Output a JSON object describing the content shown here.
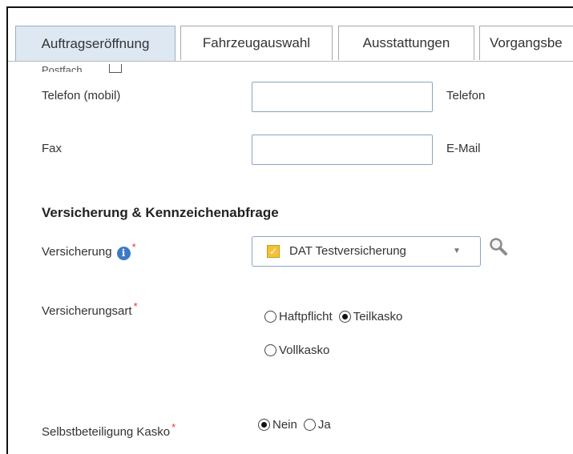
{
  "tabs": [
    {
      "label": "Auftragseröffnung",
      "active": true
    },
    {
      "label": "Fahrzeugauswahl",
      "active": false
    },
    {
      "label": "Ausstattungen",
      "active": false
    },
    {
      "label": "Vorgangsbe",
      "active": false
    }
  ],
  "partial": {
    "label": "Postfach"
  },
  "contact": {
    "phone_mobile_label": "Telefon (mobil)",
    "phone_label": "Telefon",
    "fax_label": "Fax",
    "email_label": "E-Mail"
  },
  "insurance_section": {
    "title": "Versicherung & Kennzeichenabfrage",
    "insurance_label": "Versicherung",
    "info_icon": "i",
    "required_mark": "*",
    "insurance_value": "DAT Testversicherung",
    "insurance_type_label": "Versicherungsart",
    "insurance_type_options": [
      "Haftpflicht",
      "Teilkasko",
      "Vollkasko"
    ],
    "insurance_type_selected": "Teilkasko",
    "deductible_label": "Selbstbeteiligung Kasko",
    "deductible_options": [
      "Nein",
      "Ja"
    ],
    "deductible_selected": "Nein"
  },
  "icons": {
    "info": "info-icon",
    "select_item": "insurance-icon",
    "dropdown": "chevron-down-icon",
    "lookup": "magnifier-icon"
  },
  "colors": {
    "active_tab": "#dde8f3",
    "input_border": "#8aa6c4",
    "required": "#e13a3a",
    "info": "#3d7ac4"
  }
}
